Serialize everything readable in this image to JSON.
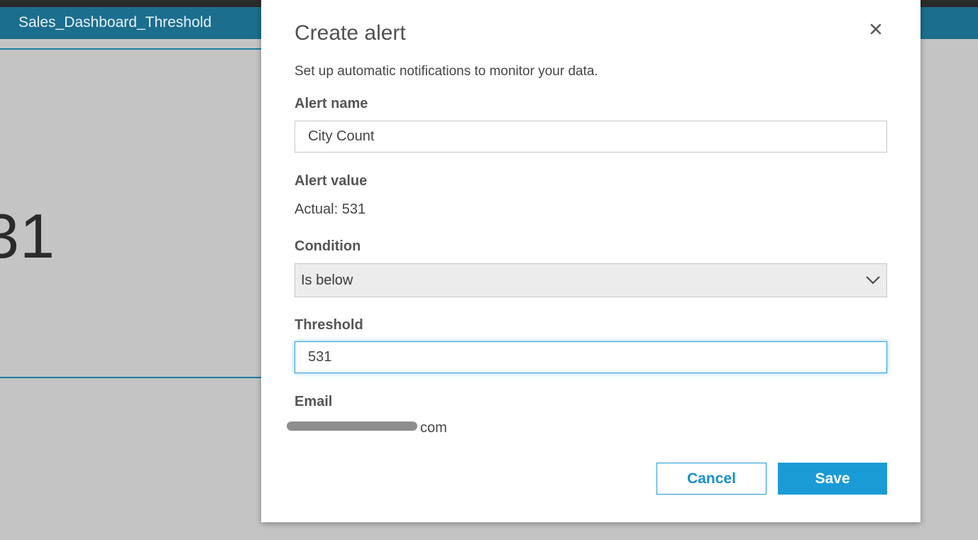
{
  "dashboard": {
    "title": "Sales_Dashboard_Threshold",
    "back_glyph": "‹",
    "kpi_value": "31"
  },
  "modal": {
    "title": "Create alert",
    "description": "Set up automatic notifications to monitor your data.",
    "alert_name": {
      "label": "Alert name",
      "value": "City Count"
    },
    "alert_value": {
      "label": "Alert value",
      "text": "Actual: 531"
    },
    "condition": {
      "label": "Condition",
      "selected": "Is below"
    },
    "threshold": {
      "label": "Threshold",
      "value": "531"
    },
    "email": {
      "label": "Email",
      "visible_text": "com"
    },
    "buttons": {
      "cancel": "Cancel",
      "save": "Save"
    }
  },
  "colors": {
    "header_bg": "#1b6e8e",
    "accent": "#1a9bd6",
    "overlay_bg": "#c4c4c4"
  },
  "icons": {
    "close": "close-icon",
    "dropdown": "chevron-down-icon",
    "back": "back-icon"
  }
}
